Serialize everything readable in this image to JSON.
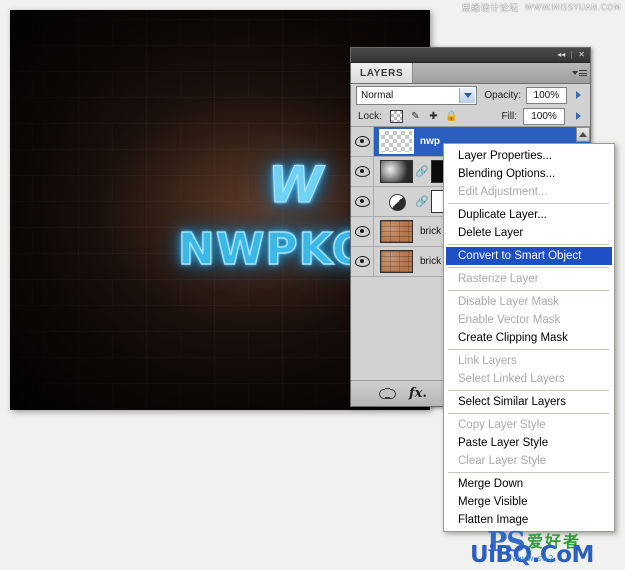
{
  "watermarks": {
    "top_cn": "思缘设计论坛",
    "top_url": "WWW.MISSYUAN.COM",
    "ps_logo": "PS",
    "cn_tagline": "爱好者",
    "uibq": "UiBQ.CoM",
    "sub_url": "www.sa2"
  },
  "canvas": {
    "neon_logo": "W",
    "neon_word": "NWPKO"
  },
  "panel": {
    "titlebar": {
      "collapse_label": "◂◂",
      "close_label": "✕"
    },
    "tab_label": "LAYERS",
    "blend_mode": "Normal",
    "opacity_label": "Opacity:",
    "opacity_value": "100%",
    "lock_label": "Lock:",
    "fill_label": "Fill:",
    "fill_value": "100%",
    "lock_icons": [
      "lock-transparent-pixels-icon",
      "lock-image-pixels-icon",
      "lock-position-icon",
      "lock-all-icon"
    ],
    "layers": [
      {
        "name": "nwp",
        "visible": true,
        "selected": true,
        "thumb": "checker",
        "has_mask": false,
        "mask": ""
      },
      {
        "name": "",
        "visible": true,
        "selected": false,
        "thumb": "blur",
        "has_mask": true,
        "mask": "black"
      },
      {
        "name": "",
        "visible": true,
        "selected": false,
        "thumb": "halfcircle",
        "has_mask": true,
        "mask": "white"
      },
      {
        "name": "brick",
        "visible": true,
        "selected": false,
        "thumb": "brick",
        "has_mask": false,
        "mask": ""
      },
      {
        "name": "brick",
        "visible": true,
        "selected": false,
        "thumb": "brick",
        "has_mask": false,
        "mask": ""
      }
    ],
    "footer_icons": [
      "link-layers-icon",
      "layer-style-fx-icon"
    ]
  },
  "context_menu": {
    "highlight_color": "#1f4fc4",
    "items": [
      {
        "label": "Layer Properties...",
        "state": "normal"
      },
      {
        "label": "Blending Options...",
        "state": "normal"
      },
      {
        "label": "Edit Adjustment...",
        "state": "disabled"
      },
      {
        "type": "separator"
      },
      {
        "label": "Duplicate Layer...",
        "state": "normal"
      },
      {
        "label": "Delete Layer",
        "state": "normal"
      },
      {
        "type": "separator"
      },
      {
        "label": "Convert to Smart Object",
        "state": "highlight"
      },
      {
        "type": "separator"
      },
      {
        "label": "Rasterize Layer",
        "state": "disabled"
      },
      {
        "type": "separator"
      },
      {
        "label": "Disable Layer Mask",
        "state": "disabled"
      },
      {
        "label": "Enable Vector Mask",
        "state": "disabled"
      },
      {
        "label": "Create Clipping Mask",
        "state": "normal"
      },
      {
        "type": "separator"
      },
      {
        "label": "Link Layers",
        "state": "disabled"
      },
      {
        "label": "Select Linked Layers",
        "state": "disabled"
      },
      {
        "type": "separator"
      },
      {
        "label": "Select Similar Layers",
        "state": "normal"
      },
      {
        "type": "separator"
      },
      {
        "label": "Copy Layer Style",
        "state": "disabled"
      },
      {
        "label": "Paste Layer Style",
        "state": "normal"
      },
      {
        "label": "Clear Layer Style",
        "state": "disabled"
      },
      {
        "type": "separator"
      },
      {
        "label": "Merge Down",
        "state": "normal"
      },
      {
        "label": "Merge Visible",
        "state": "normal"
      },
      {
        "label": "Flatten Image",
        "state": "normal"
      }
    ]
  }
}
